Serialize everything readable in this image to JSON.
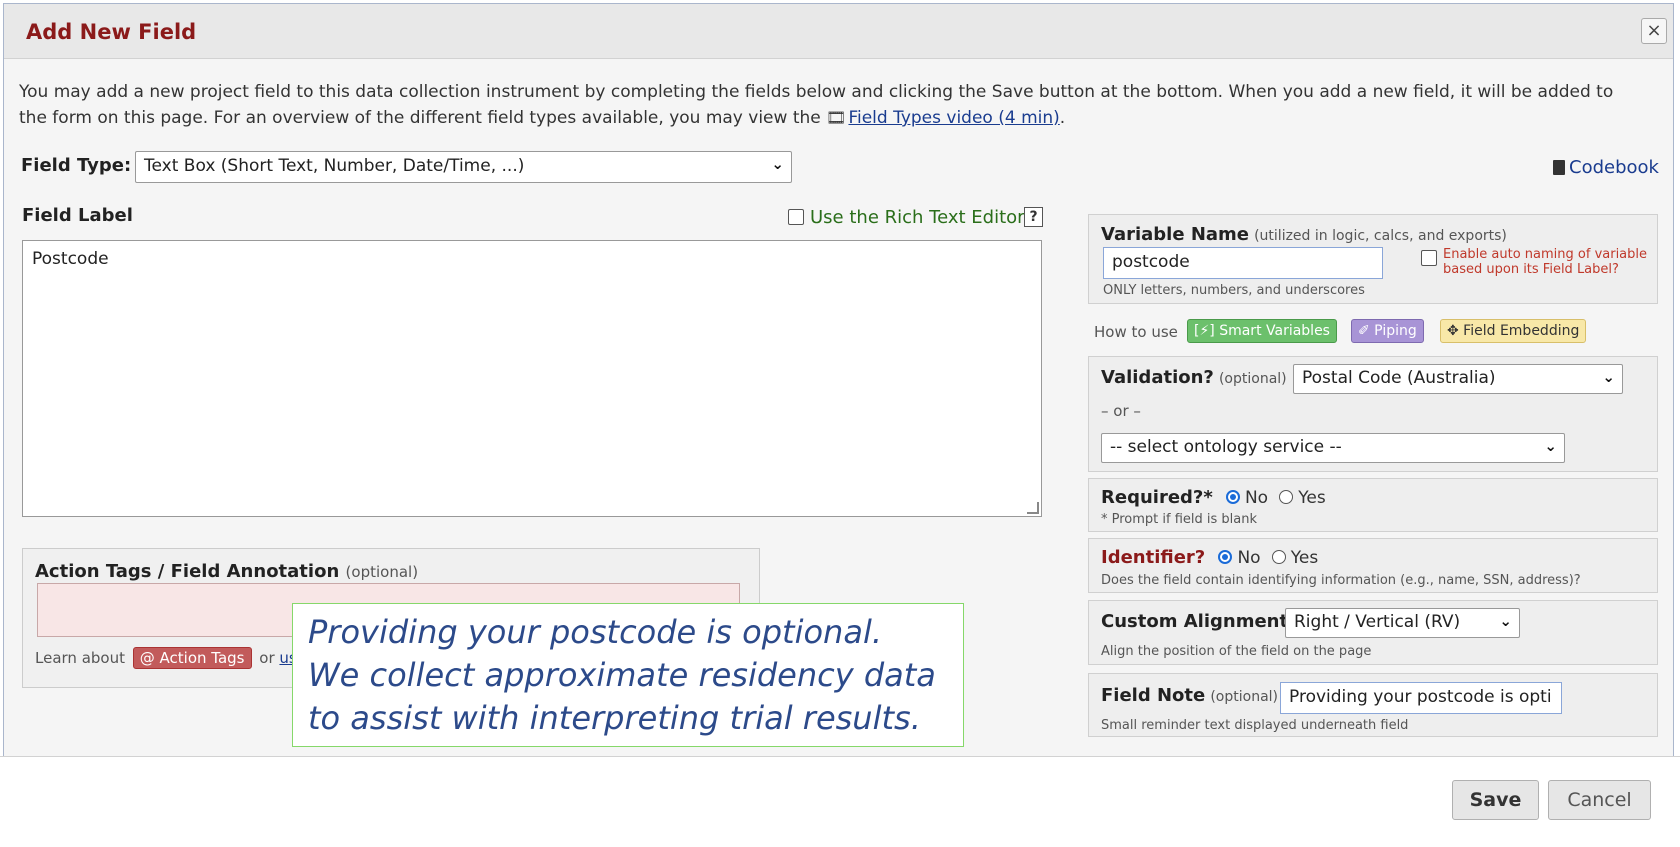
{
  "dialog": {
    "title": "Add New Field",
    "close_icon": "×"
  },
  "intro": {
    "text_before": "You may add a new project field to this data collection instrument by completing the fields below and clicking the Save button at the bottom. When you add a new field, it will be added to the form on this page. For an overview of the different field types available, you may view the ",
    "video_icon": "film-icon",
    "video_link": "Field Types video (4 min)",
    "text_after": "."
  },
  "field_type": {
    "label": "Field Type:",
    "value": "Text Box (Short Text, Number, Date/Time, ...)"
  },
  "codebook": {
    "icon": "book-icon",
    "label": "Codebook"
  },
  "field_label": {
    "label": "Field Label",
    "value": "Postcode",
    "rich_text_label": "Use the Rich Text Editor",
    "help": "?"
  },
  "action_tags": {
    "title": "Action Tags / Field Annotation",
    "optional": "(optional)",
    "learn_about": "Learn about",
    "badge": "@ Action Tags",
    "or": "or",
    "link_partial": "usi"
  },
  "tooltip": {
    "line1": "Providing your postcode is optional.",
    "line2": "We collect approximate residency data",
    "line3": "to assist with interpreting trial results."
  },
  "variable": {
    "label": "Variable Name",
    "hint": "(utilized in logic, calcs, and exports)",
    "value": "postcode",
    "rule": "ONLY letters, numbers, and underscores",
    "auto_line1": "Enable auto naming of variable",
    "auto_line2": "based upon its Field Label?"
  },
  "how_to_use": {
    "label": "How to use",
    "smart": "[⚡] Smart Variables",
    "piping": "✐ Piping",
    "embedding": "✥ Field Embedding",
    "smart_color": "#5cb85c",
    "piping_color": "#9b86c9",
    "embedding_color": "#f5e6a8"
  },
  "validation": {
    "label": "Validation?",
    "optional": "(optional)",
    "value": "Postal Code (Australia)",
    "or": "– or –",
    "ontology": "-- select ontology service --"
  },
  "required": {
    "label": "Required?*",
    "no": "No",
    "yes": "Yes",
    "note": "* Prompt if field is blank"
  },
  "identifier": {
    "label": "Identifier?",
    "no": "No",
    "yes": "Yes",
    "note": "Does the field contain identifying information (e.g., name, SSN, address)?"
  },
  "alignment": {
    "label": "Custom Alignment",
    "value": "Right / Vertical (RV)",
    "note": "Align the position of the field on the page"
  },
  "field_note": {
    "label": "Field Note",
    "optional": "(optional)",
    "value": "Providing your postcode is opti",
    "note": "Small reminder text displayed underneath field"
  },
  "footer": {
    "save": "Save",
    "cancel": "Cancel"
  }
}
